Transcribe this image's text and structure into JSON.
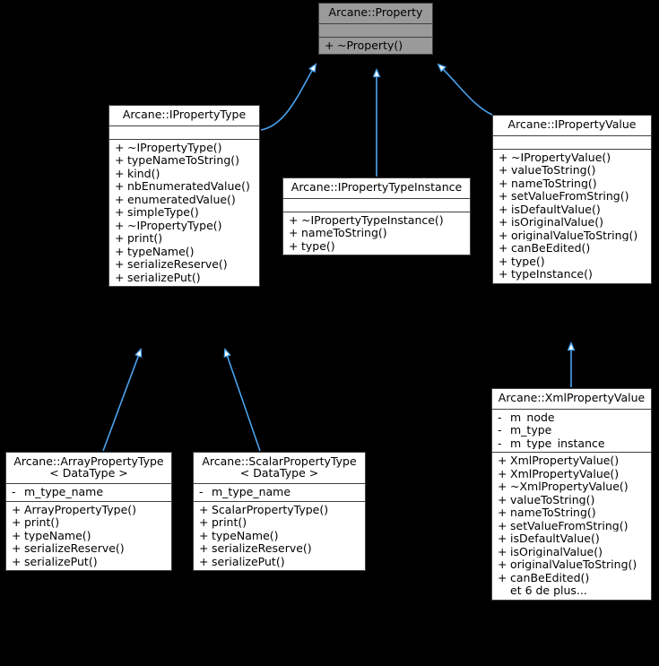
{
  "diagram": {
    "kind": "uml-class-inheritance-diagram",
    "background_color": "#000000",
    "edge_color": "#4aa3ef",
    "node_fill": "#ffffff",
    "node_shaded_fill": "#9a9a9a",
    "node_border": "#404040",
    "text_color": "#000000"
  },
  "nodes": {
    "property": {
      "title": "Arcane::Property",
      "attributes": [],
      "methods": [
        {
          "vis": "+",
          "name": "~Property()"
        }
      ]
    },
    "ipropertytype": {
      "title": "Arcane::IPropertyType",
      "attributes": [],
      "methods": [
        {
          "vis": "+",
          "name": "~IPropertyType()"
        },
        {
          "vis": "+",
          "name": "typeNameToString()"
        },
        {
          "vis": "+",
          "name": "kind()"
        },
        {
          "vis": "+",
          "name": "nbEnumeratedValue()"
        },
        {
          "vis": "+",
          "name": "enumeratedValue()"
        },
        {
          "vis": "+",
          "name": "simpleType()"
        },
        {
          "vis": "+",
          "name": "~IPropertyType()"
        },
        {
          "vis": "+",
          "name": "print()"
        },
        {
          "vis": "+",
          "name": "typeName()"
        },
        {
          "vis": "+",
          "name": "serializeReserve()"
        },
        {
          "vis": "+",
          "name": "serializePut()"
        }
      ]
    },
    "itypeinstance": {
      "title": "Arcane::IPropertyTypeInstance",
      "attributes": [],
      "methods": [
        {
          "vis": "+",
          "name": "~IPropertyTypeInstance()"
        },
        {
          "vis": "+",
          "name": "nameToString()"
        },
        {
          "vis": "+",
          "name": "type()"
        }
      ]
    },
    "ipropertyvalue": {
      "title": "Arcane::IPropertyValue",
      "attributes": [],
      "methods": [
        {
          "vis": "+",
          "name": "~IPropertyValue()"
        },
        {
          "vis": "+",
          "name": "valueToString()"
        },
        {
          "vis": "+",
          "name": "nameToString()"
        },
        {
          "vis": "+",
          "name": "setValueFromString()"
        },
        {
          "vis": "+",
          "name": "isDefaultValue()"
        },
        {
          "vis": "+",
          "name": "isOriginalValue()"
        },
        {
          "vis": "+",
          "name": "originalValueToString()"
        },
        {
          "vis": "+",
          "name": "canBeEdited()"
        },
        {
          "vis": "+",
          "name": "type()"
        },
        {
          "vis": "+",
          "name": "typeInstance()"
        }
      ]
    },
    "arraytype": {
      "title": "Arcane::ArrayPropertyType\n< DataType >",
      "attributes": [
        {
          "vis": "-",
          "name": "m_type_name"
        }
      ],
      "methods": [
        {
          "vis": "+",
          "name": "ArrayPropertyType()"
        },
        {
          "vis": "+",
          "name": "print()"
        },
        {
          "vis": "+",
          "name": "typeName()"
        },
        {
          "vis": "+",
          "name": "serializeReserve()"
        },
        {
          "vis": "+",
          "name": "serializePut()"
        }
      ]
    },
    "scalartype": {
      "title": "Arcane::ScalarPropertyType\n< DataType >",
      "attributes": [
        {
          "vis": "-",
          "name": "m_type_name"
        }
      ],
      "methods": [
        {
          "vis": "+",
          "name": "ScalarPropertyType()"
        },
        {
          "vis": "+",
          "name": "print()"
        },
        {
          "vis": "+",
          "name": "typeName()"
        },
        {
          "vis": "+",
          "name": "serializeReserve()"
        },
        {
          "vis": "+",
          "name": "serializePut()"
        }
      ]
    },
    "xmlvalue": {
      "title": "Arcane::XmlPropertyValue",
      "attributes": [
        {
          "vis": "-",
          "name": "m_node"
        },
        {
          "vis": "-",
          "name": "m_type"
        },
        {
          "vis": "-",
          "name": "m_type_instance"
        }
      ],
      "methods": [
        {
          "vis": "+",
          "name": "XmlPropertyValue()"
        },
        {
          "vis": "+",
          "name": "XmlPropertyValue()"
        },
        {
          "vis": "+",
          "name": "~XmlPropertyValue()"
        },
        {
          "vis": "+",
          "name": "valueToString()"
        },
        {
          "vis": "+",
          "name": "nameToString()"
        },
        {
          "vis": "+",
          "name": "setValueFromString()"
        },
        {
          "vis": "+",
          "name": "isDefaultValue()"
        },
        {
          "vis": "+",
          "name": "isOriginalValue()"
        },
        {
          "vis": "+",
          "name": "originalValueToString()"
        },
        {
          "vis": "+",
          "name": "canBeEdited()"
        },
        {
          "vis": "",
          "name": "et 6 de plus..."
        }
      ]
    }
  },
  "edges": [
    {
      "from": "ipropertytype",
      "to": "property",
      "relation": "inheritance"
    },
    {
      "from": "itypeinstance",
      "to": "property",
      "relation": "inheritance"
    },
    {
      "from": "ipropertyvalue",
      "to": "property",
      "relation": "inheritance"
    },
    {
      "from": "arraytype",
      "to": "ipropertytype",
      "relation": "inheritance"
    },
    {
      "from": "scalartype",
      "to": "ipropertytype",
      "relation": "inheritance"
    },
    {
      "from": "xmlvalue",
      "to": "ipropertyvalue",
      "relation": "inheritance"
    }
  ]
}
